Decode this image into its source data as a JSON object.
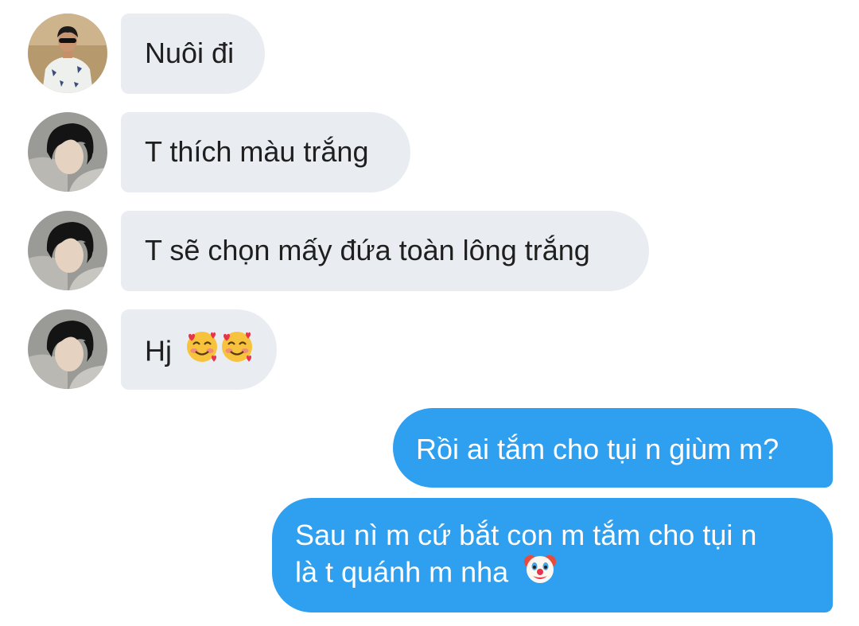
{
  "messages": [
    {
      "id": "m1",
      "direction": "incoming",
      "sender": "friend-a",
      "text": "Nuôi đi"
    },
    {
      "id": "m2",
      "direction": "incoming",
      "sender": "friend-b",
      "text": "T thích màu trắng"
    },
    {
      "id": "m3",
      "direction": "incoming",
      "sender": "friend-b",
      "text": "T sẽ chọn mấy đứa toàn lông trắng"
    },
    {
      "id": "m4",
      "direction": "incoming",
      "sender": "friend-b",
      "text": "Hj",
      "emoji": [
        "smiling-face-with-hearts-emoji",
        "smiling-face-with-hearts-emoji"
      ]
    },
    {
      "id": "m5",
      "direction": "outgoing",
      "text": "Rồi ai tắm cho tụi n giùm m?"
    },
    {
      "id": "m6",
      "direction": "outgoing",
      "lines": [
        "Sau nì m cứ bắt con m tắm cho tụi n",
        "là t quánh m nha"
      ],
      "emoji": [
        "clown-face-emoji"
      ]
    }
  ],
  "colors": {
    "incoming_bubble": "#e9edf1",
    "outgoing_bubble": "#2f9ff0",
    "incoming_text": "#1f1f1f",
    "outgoing_text": "#ffffff"
  }
}
